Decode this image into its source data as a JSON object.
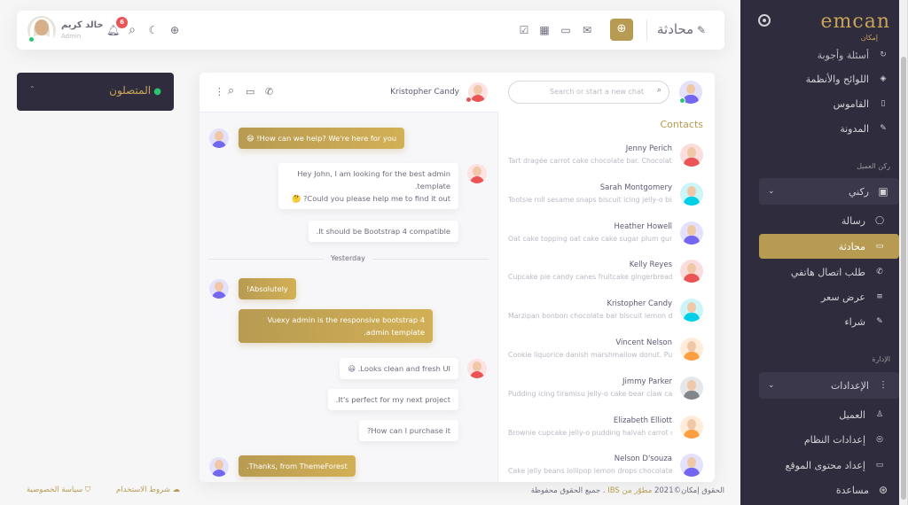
{
  "topbar": {
    "user_name": "خالد كريم",
    "user_role": "Admin",
    "notification_count": "6",
    "page_title": "محادثة"
  },
  "sidebar": {
    "logo": "emcan",
    "logo_sub": "إمكان",
    "items_top": [
      {
        "label": "أسئلة وأجوبة",
        "icon": "refresh-icon"
      },
      {
        "label": "اللوائح والأنظمة",
        "icon": "layers-icon"
      },
      {
        "label": "القاموس",
        "icon": "book-icon"
      },
      {
        "label": "المدونة",
        "icon": "feather-icon"
      }
    ],
    "group_client": "ركن العميل",
    "my_corner": "ركني",
    "items_client": [
      {
        "label": "رسالة",
        "icon": "message-icon"
      },
      {
        "label": "محادثة",
        "icon": "chat-icon",
        "active": true
      },
      {
        "label": "طلب اتصال هاتفي",
        "icon": "phone-icon"
      },
      {
        "label": "عرض سعر",
        "icon": "list-icon"
      },
      {
        "label": "شراء",
        "icon": "feather-icon"
      }
    ],
    "group_admin": "الإدارة",
    "settings": "الإعدادات",
    "items_admin": [
      {
        "label": "العميل",
        "icon": "user-icon"
      },
      {
        "label": "إعدادات النظام",
        "icon": "target-icon"
      },
      {
        "label": "إعداد محتوى الموقع",
        "icon": "monitor-icon"
      }
    ],
    "help": "مساعدة"
  },
  "online": {
    "label": "المتصلون"
  },
  "chat": {
    "contact_name": "Kristopher Candy",
    "search_placeholder": "Search or start a new chat",
    "contacts_title": "Contacts",
    "divider": "Yesterday",
    "messages": [
      {
        "side": "left",
        "text": "How can we help? We're here for you! 😄"
      },
      {
        "side": "right",
        "text": "Hey John, I am looking for the best admin template."
      },
      {
        "side": "right",
        "text": "Could you please help me to find it out? 🤔"
      },
      {
        "side": "right",
        "text": "It should be Bootstrap 4 compatible."
      },
      {
        "side": "left",
        "text": "Absolutely!"
      },
      {
        "side": "left",
        "text": "Vuexy admin is the responsive bootstrap 4 admin template."
      },
      {
        "side": "right",
        "text": "Looks clean and fresh UI. 😃"
      },
      {
        "side": "right",
        "text": "It's perfect for my next project."
      },
      {
        "side": "right",
        "text": "How can I purchase it?"
      },
      {
        "side": "left",
        "text": "Thanks, from ThemeForest."
      }
    ],
    "contacts": [
      {
        "name": "Jenny Perich",
        "msg": "Tart dragée carrot cake chocolate bar. Chocolate cake jelly beans caramels tootsie roll candy canes.",
        "color": "#ea5455"
      },
      {
        "name": "Sarah Montgomery",
        "msg": "Tootsie roll sesame snaps biscuit icing jelly-o biscuit chupa chups powder.",
        "color": "#00cfe8"
      },
      {
        "name": "Heather Howell",
        "msg": "Oat cake topping oat cake cake sugar plum gummies cheesecake toffee.",
        "color": "#7367f0"
      },
      {
        "name": "Kelly Reyes",
        "msg": "Cupcake pie candy canes fruitcake gingerbread tiramisu sweet jelly-o.",
        "color": "#ea5455"
      },
      {
        "name": "Kristopher Candy",
        "msg": "Marzipan bonbon chocolate bar biscuit lemon drops muffin jelly-o sweet jujubes.",
        "color": "#00cfe8"
      },
      {
        "name": "Vincent Nelson",
        "msg": "Cookie liquorice danish marshmallow donut. Pudding cookie lemon drops icing.",
        "color": "#ff9f43"
      },
      {
        "name": "Jimmy Parker",
        "msg": "Pudding icing tiramisu jelly-o cake bear claw caramels muffin dragée lollipop oat cake.",
        "color": "#82868b"
      },
      {
        "name": "Elizabeth Elliott",
        "msg": "Brownie cupcake jelly-o pudding halvah carrot cake chocolate bar pastry candy jelly-o.",
        "color": "#ff9f43"
      },
      {
        "name": "Nelson D'souza",
        "msg": "Cake jelly beans lollipop lemon drops chocolate cake sweet pastry.",
        "color": "#7367f0"
      }
    ]
  },
  "footer": {
    "copyright_pre": "الحقوق إمكان©2021",
    "developer": "مطوّر من IBS",
    "copyright_post": ". جميع الحقوق محفوظة",
    "terms": "شروط الاستخدام",
    "privacy": "سياسة الخصوصية"
  }
}
